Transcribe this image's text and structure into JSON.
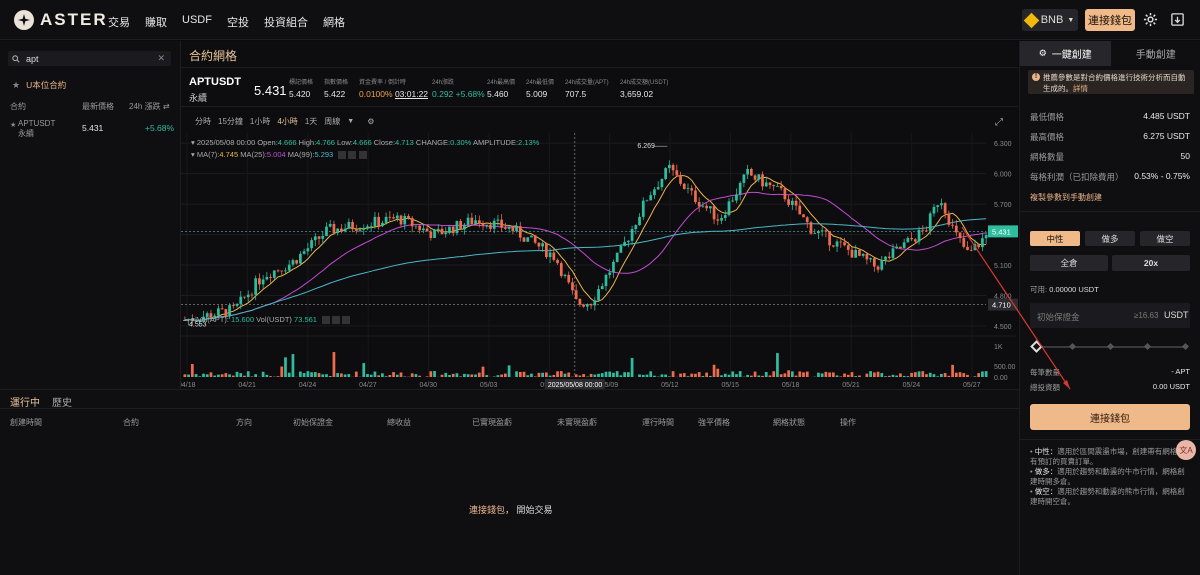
{
  "brand": {
    "name": "ASTER"
  },
  "nav": [
    "交易",
    "賺取",
    "USDF",
    "空投",
    "投資組合",
    "網格"
  ],
  "topbar": {
    "network": "BNB",
    "connect_label": "連接錢包"
  },
  "left": {
    "search_value": "apt",
    "filter_label": "U本位合約",
    "cols": {
      "contract": "合約",
      "price": "最新價格",
      "change": "24h 漲跌"
    },
    "rows": [
      {
        "sym": "APTUSDT",
        "sub": "永續",
        "price": "5.431",
        "change": "+5.68%"
      }
    ]
  },
  "chart_header": {
    "title": "合約網格",
    "symbol": "APTUSDT",
    "type": "永續",
    "price": "5.431",
    "stats": [
      {
        "k": "標記價格",
        "v": "5.420"
      },
      {
        "k": "指數價格",
        "v": "5.422"
      },
      {
        "k": "資金費率 / 倒計時",
        "v1": "0.0100%",
        "v2": "03:01:22"
      },
      {
        "k": "24h漲跌",
        "v1": "0.292",
        "v2": "+5.68%"
      },
      {
        "k": "24h最高價",
        "v": "5.460"
      },
      {
        "k": "24h最低價",
        "v": "5.009"
      },
      {
        "k": "24h成交量(APT)",
        "v": "707.5"
      },
      {
        "k": "24h成交額(USDT)",
        "v": "3,659.02"
      }
    ],
    "timeframes": [
      "分時",
      "15分鐘",
      "1小時",
      "4小時",
      "1天",
      "周線"
    ],
    "active_tf": "4小時"
  },
  "ohlc_line": {
    "date": "2025/05/08 00:00",
    "open_k": "Open:",
    "open": "4.666",
    "high_k": "High:",
    "high": "4.766",
    "low_k": "Low:",
    "low": "4.666",
    "close_k": "Close:",
    "close": "4.713",
    "chg_k": "CHANGE:",
    "chg": "0.30%",
    "amp_k": "AMPLITUDE:",
    "amp": "2.13%"
  },
  "ma_line": {
    "ma7_k": "MA(7):",
    "ma7": "4.745",
    "ma25_k": "MA(25):",
    "ma25": "5.004",
    "ma99_k": "MA(99):",
    "ma99": "5.293"
  },
  "vol_line": {
    "apt_k": "Vol(APT):",
    "apt": "15.600",
    "usdt_k": "Vol(USDT)",
    "usdt": "73.561"
  },
  "chart_data": {
    "type": "candlestick",
    "x_ticks": [
      "04/18",
      "04/21",
      "04/24",
      "04/27",
      "04/30",
      "05/03",
      "05/06",
      "05/09",
      "05/12",
      "05/15",
      "05/18",
      "05/21",
      "05/24",
      "05/27"
    ],
    "price_ticks": [
      "6.300",
      "6.000",
      "5.700",
      "5.400",
      "5.100",
      "4.800",
      "4.500"
    ],
    "vol_ticks": [
      "1K",
      "500.00",
      "0.00"
    ],
    "ylim": [
      4.45,
      6.4
    ],
    "high_label": "6.269",
    "low_label": "4.553",
    "last_price": "5.431",
    "cross_price": "4.710",
    "cross_time": "2025/05/08 00:00",
    "series": [
      {
        "name": "MA(7)",
        "color": "#e8b64c"
      },
      {
        "name": "MA(25)",
        "color": "#c24bd3"
      },
      {
        "name": "MA(99)",
        "color": "#4cb7c9"
      }
    ],
    "candle_count": 216
  },
  "bottom": {
    "tabs": [
      "運行中",
      "歷史"
    ],
    "cols": [
      "創建時間",
      "合約",
      "方向",
      "初始保證金",
      "總收益",
      "已實現盈虧",
      "未實現盈虧",
      "運行時間",
      "強平價格",
      "網格狀態",
      "操作"
    ],
    "empty_link": "連接錢包",
    "empty_sep": "，",
    "empty_text": "開始交易"
  },
  "right": {
    "tab_auto": "一鍵創建",
    "tab_manual": "手動創建",
    "notice": "推薦參數是對合約價格進行技術分析而自動生成的。",
    "notice_link": "詳情",
    "params": [
      {
        "k": "最低價格",
        "v": "4.485 USDT"
      },
      {
        "k": "最高價格",
        "v": "6.275 USDT"
      },
      {
        "k": "網格數量",
        "v": "50"
      },
      {
        "k": "每格利潤（已扣除費用）",
        "v": "0.53% - 0.75%"
      }
    ],
    "copy_link": "複製參數到手動創建",
    "modes": [
      "中性",
      "做多",
      "做空"
    ],
    "margin_mode": "全倉",
    "leverage": "20x",
    "available_k": "可用:",
    "available_v": "0.00000 USDT",
    "margin_placeholder": "初始保證金",
    "margin_hint": "≥16.63",
    "margin_unit": "USDT",
    "per_grid_k": "每筆數量",
    "per_grid_v": "- APT",
    "total_k": "總投資額",
    "total_v": "0.00 USDT",
    "connect": "連接錢包",
    "bullets": [
      {
        "t": "中性：",
        "d": "適用於區間震盪市場，創建帶有網格沒有預訂的買賣訂單。"
      },
      {
        "t": "做多：",
        "d": "適用於趨勢和動盪的牛市行情，網格創建時開多倉。"
      },
      {
        "t": "做空：",
        "d": "適用於趨勢和動盪的熊市行情，網格創建時開空倉。"
      }
    ]
  },
  "colors": {
    "accent": "#f0b98a",
    "up": "#2ebd9f",
    "down": "#ef6b4d"
  }
}
